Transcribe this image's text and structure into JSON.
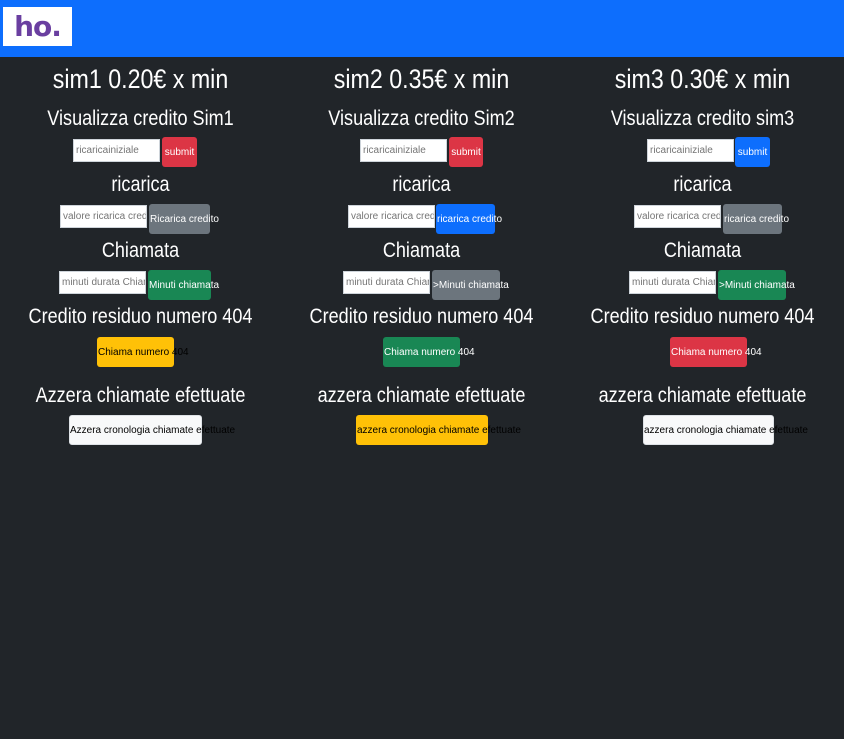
{
  "navbar": {
    "logo_text": "ho."
  },
  "columns": [
    {
      "title": "sim1 0.20€ x min",
      "credit_heading": "Visualizza credito Sim1",
      "credit_placeholder": "ricaricainiziale",
      "credit_button": "submit",
      "recharge_heading": "ricarica",
      "recharge_placeholder": "valore ricarica credito",
      "recharge_button": "Ricarica credito",
      "call_heading": "Chiamata",
      "call_placeholder": "minuti durata Chiamata",
      "call_button": "Minuti chiamata",
      "residual_heading": "Credito residuo numero 404",
      "residual_button": "Chiama numero 404",
      "reset_heading": "Azzera chiamate efettuate",
      "reset_button": "Azzera cronologia chiamate efettuate"
    },
    {
      "title": "sim2 0.35€ x min",
      "credit_heading": "Visualizza credito Sim2",
      "credit_placeholder": "ricaricainiziale",
      "credit_button": "submit",
      "recharge_heading": "ricarica",
      "recharge_placeholder": "valore ricarica credito",
      "recharge_button": "ricarica credito",
      "call_heading": "Chiamata",
      "call_placeholder": "minuti durata Chiamata",
      "call_button": ">Minuti chiamata",
      "residual_heading": "Credito residuo numero 404",
      "residual_button": "Chiama numero 404",
      "reset_heading": "azzera chiamate efettuate",
      "reset_button": "azzera cronologia chiamate efettuate"
    },
    {
      "title": "sim3 0.30€ x min",
      "credit_heading": "Visualizza credito sim3",
      "credit_placeholder": "ricaricainiziale",
      "credit_button": "submit",
      "recharge_heading": "ricarica",
      "recharge_placeholder": "valore ricarica credito",
      "recharge_button": "ricarica credito",
      "call_heading": "Chiamata",
      "call_placeholder": "minuti durata Chiamata",
      "call_button": ">Minuti chiamata",
      "residual_heading": "Credito residuo numero 404",
      "residual_button": "Chiama numero 404",
      "reset_heading": "azzera chiamate efettuate",
      "reset_button": "azzera cronologia chiamate efettuate"
    }
  ],
  "colors": {
    "navbar": "#0d6efd",
    "background": "#212529",
    "danger": "#dc3545",
    "secondary": "#6c757d",
    "primary": "#0d6efd",
    "success": "#198754",
    "warning": "#ffc107",
    "light": "#f8f9fa"
  }
}
